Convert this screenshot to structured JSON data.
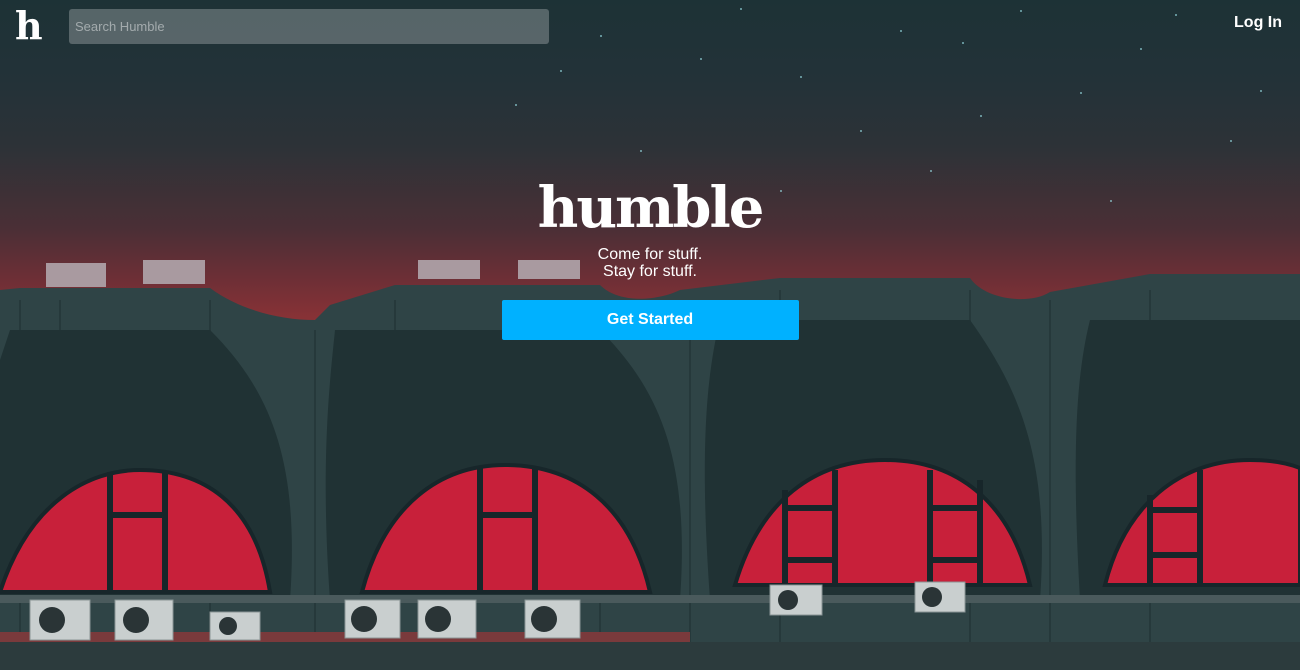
{
  "header": {
    "logo_text": "h",
    "search_placeholder": "Search Humble",
    "login_label": "Log In"
  },
  "hero": {
    "brand": "humble",
    "tagline_line1": "Come for stuff.",
    "tagline_line2": "Stay for stuff.",
    "cta_label": "Get Started"
  },
  "colors": {
    "cta": "#00b1ff",
    "sky_top": "#1d3236",
    "sky_bottom": "#8d3438",
    "window_red": "#c8203a"
  }
}
